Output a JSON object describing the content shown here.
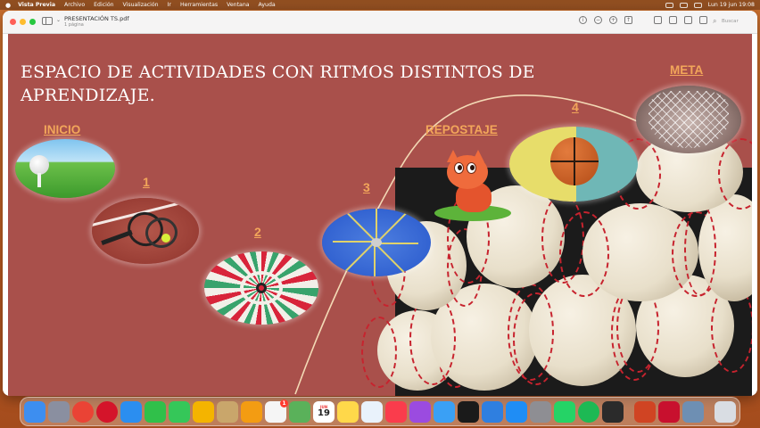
{
  "menubar": {
    "app_name": "Vista Previa",
    "items": [
      "Archivo",
      "Edición",
      "Visualización",
      "Ir",
      "Herramientas",
      "Ventana",
      "Ayuda"
    ],
    "clock": "Lun 19 jun 19:08"
  },
  "window": {
    "doc_title": "PRESENTACIÓN TS.pdf",
    "doc_subtitle": "1 página",
    "search_placeholder": "Buscar"
  },
  "slide": {
    "title": "ESPACIO DE ACTIVIDADES CON RITMOS DISTINTOS DE APRENDIZAJE.",
    "labels": {
      "inicio": "INICIO",
      "repostaje": "REPOSTAJE",
      "meta": "META"
    },
    "steps": [
      "1",
      "2",
      "3",
      "4"
    ]
  },
  "dock": {
    "calendar_month": "JUN",
    "calendar_day": "19",
    "reminders_badge": "1",
    "items": [
      {
        "name": "finder-icon",
        "color": "#3d8ef0"
      },
      {
        "name": "launchpad-icon",
        "color": "#8a8fa0"
      },
      {
        "name": "chrome-icon",
        "color": "#ea4335"
      },
      {
        "name": "opera-icon",
        "color": "#d4142a"
      },
      {
        "name": "safari-icon",
        "color": "#2b8ef0"
      },
      {
        "name": "facetime-icon",
        "color": "#30c04a"
      },
      {
        "name": "messages-icon",
        "color": "#35c759"
      },
      {
        "name": "photos-icon",
        "color": "#f4b400"
      },
      {
        "name": "finder-folder-icon",
        "color": "#c9a66b"
      },
      {
        "name": "pages-icon",
        "color": "#f39c12"
      },
      {
        "name": "reminders-icon",
        "color": "#f5f5f5"
      },
      {
        "name": "maps-icon",
        "color": "#5ab15a"
      },
      {
        "name": "calendar-icon",
        "color": "#ffffff"
      },
      {
        "name": "notes-icon",
        "color": "#ffd84a"
      },
      {
        "name": "freeform-icon",
        "color": "#e9f2fb"
      },
      {
        "name": "music-icon",
        "color": "#fa3c4c"
      },
      {
        "name": "podcasts-icon",
        "color": "#9b4be0"
      },
      {
        "name": "mail-icon",
        "color": "#3aa0f5"
      },
      {
        "name": "appletv-icon",
        "color": "#1a1a1a"
      },
      {
        "name": "keynote-icon",
        "color": "#2f7fe0"
      },
      {
        "name": "appstore-icon",
        "color": "#1f8df5"
      },
      {
        "name": "settings-icon",
        "color": "#8e8e93"
      },
      {
        "name": "whatsapp-icon",
        "color": "#25d366"
      },
      {
        "name": "spotify-icon",
        "color": "#1db954"
      },
      {
        "name": "activity-icon",
        "color": "#2b2b2b"
      },
      {
        "name": "powerpoint-icon",
        "color": "#d04423"
      },
      {
        "name": "screenrecord-icon",
        "color": "#c8102e"
      },
      {
        "name": "preview-icon",
        "color": "#6e8fb3"
      },
      {
        "name": "trash-icon",
        "color": "#d9dde3"
      }
    ]
  }
}
